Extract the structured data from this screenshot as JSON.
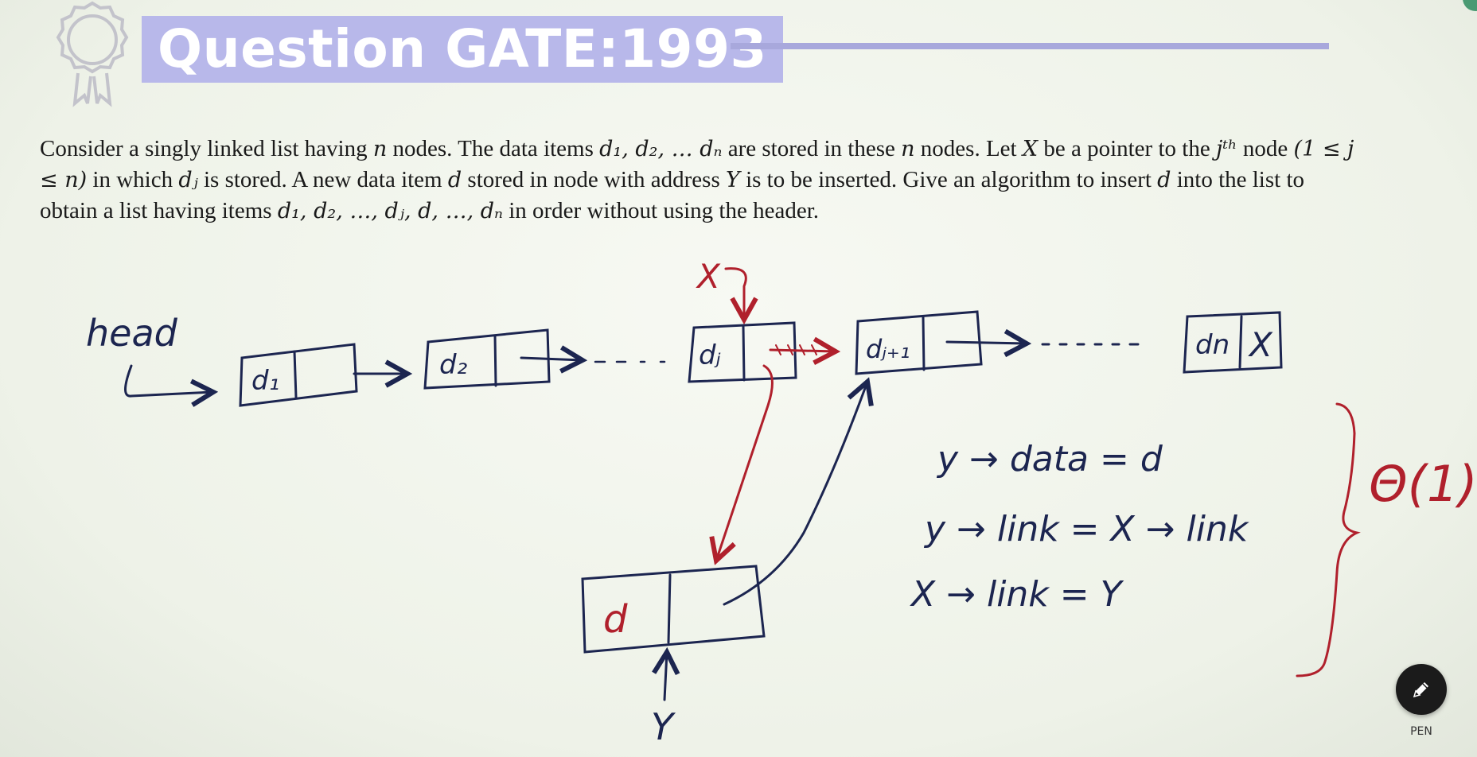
{
  "slide": {
    "title": "Question GATE:1993",
    "question": {
      "part1": "Consider a singly linked list having ",
      "n1": "n",
      "part2": " nodes. The data items ",
      "items1": "d₁, d₂, … dₙ",
      "part3": " are stored in these ",
      "n2": "n",
      "part4": " nodes. Let ",
      "X1": "X",
      "part5": " be a pointer to the ",
      "jth": "jᵗʰ",
      "part6": " node ",
      "range": "(1 ≤ j ≤ n)",
      "part7": " in which ",
      "dj": "dⱼ",
      "part8": " is stored. A new data item ",
      "d1": "d",
      "part9": " stored in node with address ",
      "Y1": "Y",
      "part10": " is to be inserted. Give an algorithm to insert ",
      "d2": "d",
      "part11": " into the list to obtain a list having items ",
      "items2": "d₁, d₂, …, dⱼ, d, …, dₙ",
      "part12": " in order without using the header."
    }
  },
  "annotations": {
    "head": "head",
    "node_d1": "d₁",
    "node_d2": "d₂",
    "node_dj": "dⱼ",
    "node_dj1": "dⱼ₊₁",
    "node_dn": "dn",
    "node_dn_link": "X",
    "pointer_x": "X",
    "node_d": "d",
    "pointer_y": "Y",
    "step1": "y → data = d",
    "step2": "y → link = X → link",
    "step3": "X → link = Y",
    "complexity": "Θ(1)"
  },
  "toolbar": {
    "pen_label": "PEN"
  },
  "colors": {
    "ink_blue": "#1c2550",
    "ink_red": "#b0202c",
    "title_bg": "#b8b8ea"
  }
}
